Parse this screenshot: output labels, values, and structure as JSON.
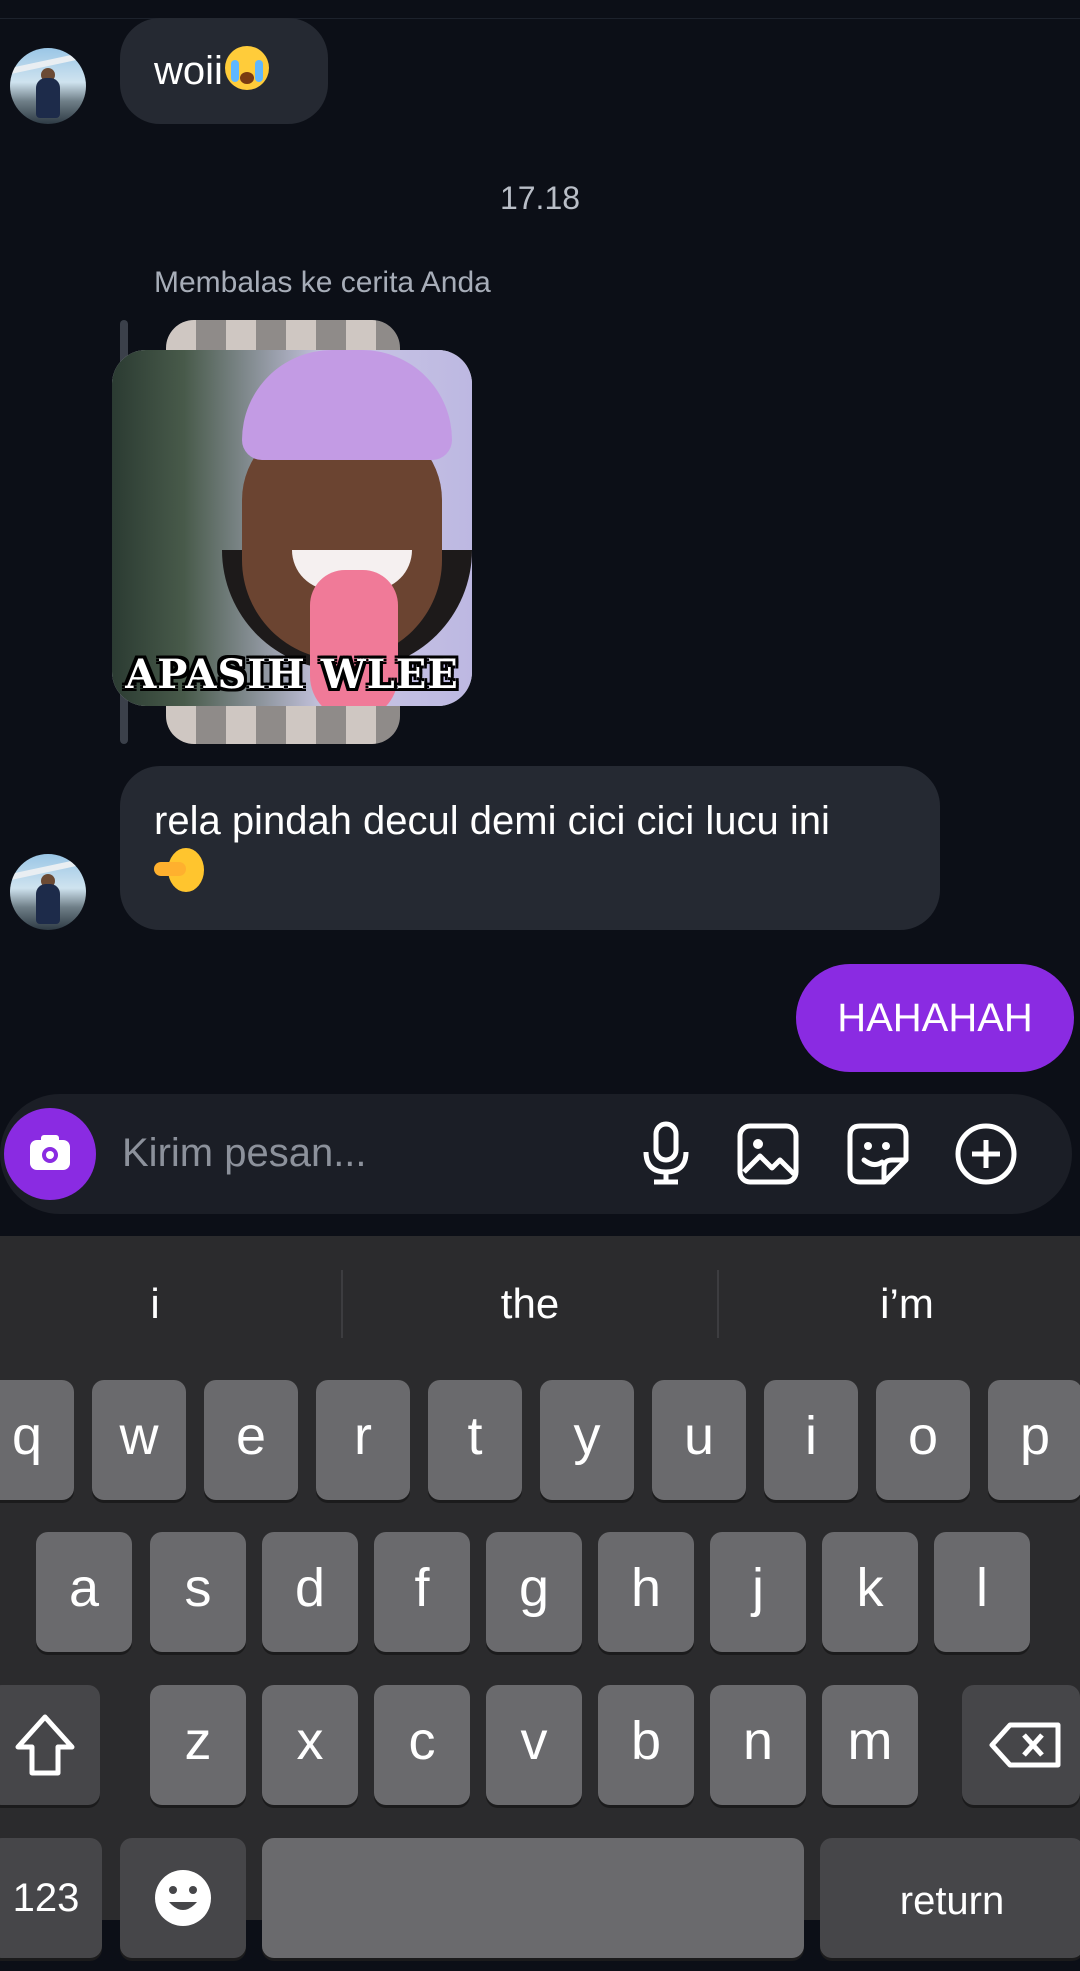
{
  "messages": {
    "first_text": "woii",
    "timestamp": "17.18",
    "reply_label": "Membalas ke cerita Anda",
    "sticker_caption": "APASIH WLEE",
    "second_line1": "rela pindah decul demi cici cici lucu ini",
    "outgoing": "HAHAHAH"
  },
  "composer": {
    "placeholder": "Kirim pesan...",
    "accent_color": "#8a2be2"
  },
  "keyboard": {
    "suggestions": [
      "i",
      "the",
      "i’m"
    ],
    "row1": [
      "q",
      "w",
      "e",
      "r",
      "t",
      "y",
      "u",
      "i",
      "o",
      "p"
    ],
    "row2": [
      "a",
      "s",
      "d",
      "f",
      "g",
      "h",
      "j",
      "k",
      "l"
    ],
    "row3": [
      "z",
      "x",
      "c",
      "v",
      "b",
      "n",
      "m"
    ],
    "numbers_label": "123",
    "return_label": "return"
  }
}
